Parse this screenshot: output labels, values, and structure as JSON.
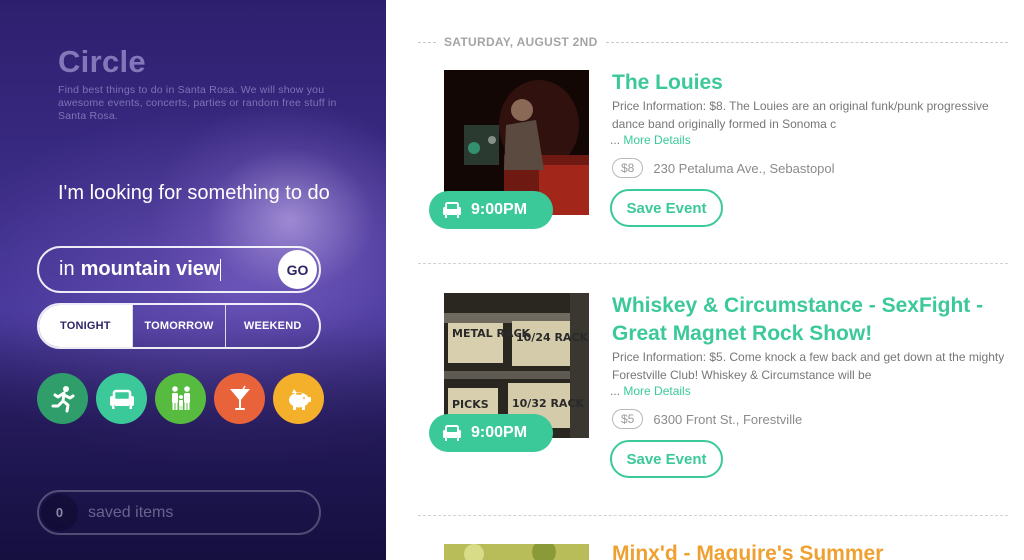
{
  "app": {
    "brand": "Circle",
    "tagline": "Find best things to do in Santa Rosa. We will show you awesome events, concerts, parties or random free stuff in Santa Rosa."
  },
  "search": {
    "lead": "I'm looking for something to do",
    "prefix": "in",
    "location": "mountain view",
    "go_label": "GO"
  },
  "when": {
    "options": [
      "TONIGHT",
      "TOMORROW",
      "WEEKEND"
    ],
    "selected": "TONIGHT"
  },
  "categories": [
    {
      "icon": "running-figure-icon",
      "color": "#2f9e6b"
    },
    {
      "icon": "sofa-icon",
      "color": "#3cc99a"
    },
    {
      "icon": "family-icon",
      "color": "#56bb3f"
    },
    {
      "icon": "cocktail-icon",
      "color": "#e8623a"
    },
    {
      "icon": "piggy-bank-icon",
      "color": "#f4b02b"
    }
  ],
  "saved": {
    "count": "0",
    "label": "saved items"
  },
  "feed": {
    "date_heading": "SATURDAY, AUGUST 2ND",
    "events": [
      {
        "title": "The Louies",
        "description": "Price Information: $8. The Louies are an original funk/punk progressive dance band originally formed in Sonoma c",
        "more_prefix": "...",
        "more_label": "More Details",
        "price": "$8",
        "address": "230 Petaluma Ave., Sebastopol",
        "time": "9:00PM",
        "save_label": "Save Event"
      },
      {
        "title": "Whiskey & Circumstance - SexFight - Great Magnet Rock Show!",
        "description": "Price Information: $5. Come knock a few back and get down at the mighty Forestville Club! Whiskey & Circumstance will be",
        "more_prefix": "...",
        "more_label": "More Details",
        "price": "$5",
        "address": "6300 Front St., Forestville",
        "time": "9:00PM",
        "save_label": "Save Event",
        "thumb_text": [
          "METAL RACK",
          "10/24 RACK",
          "PICKS",
          "10/32 RACK"
        ]
      },
      {
        "title": "Minx'd - Maguire's Summer"
      }
    ]
  },
  "colors": {
    "accent": "#3cc99a",
    "panel": "#3b2c86",
    "orange_title": "#f0a030"
  }
}
